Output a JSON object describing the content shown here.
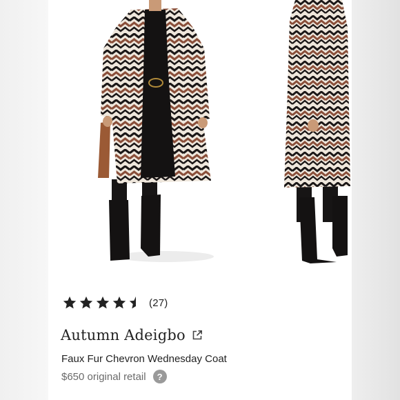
{
  "product": {
    "rating": 4.5,
    "review_count": "(27)",
    "designer": "Autumn Adeigbo",
    "name": "Faux Fur Chevron Wednesday Coat",
    "price": "$650 original retail"
  },
  "icons": {
    "star": "star-icon",
    "external_link": "external-link-icon",
    "help": "question-mark-icon"
  },
  "colors": {
    "star": "#222222",
    "price_text": "#6a6a6a",
    "help_badge": "#9a9a9a"
  }
}
